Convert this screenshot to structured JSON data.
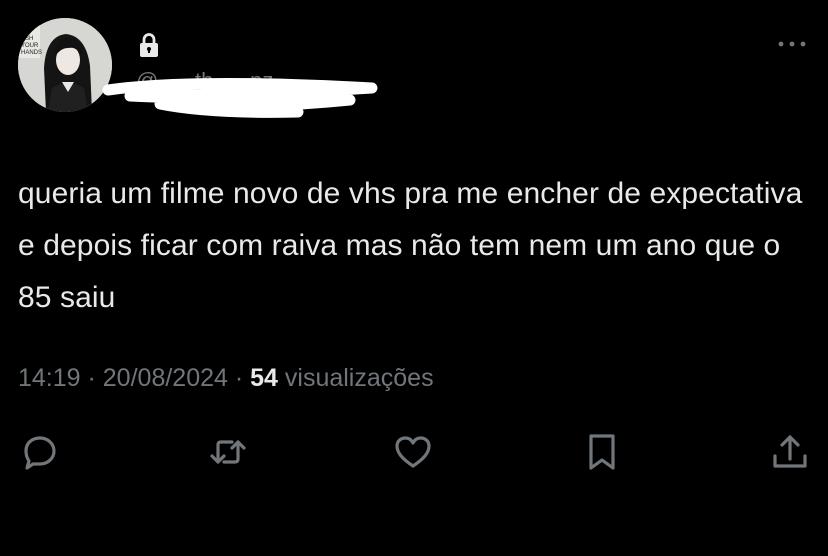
{
  "user": {
    "handle": "@___th___nz",
    "protected": true,
    "avatar_text": [
      "ASH",
      "YOUR",
      "HANDS"
    ]
  },
  "tweet": {
    "text": "queria um filme novo de vhs pra me encher de expectativa e depois ficar com raiva mas não tem nem um ano que o 85 saiu"
  },
  "meta": {
    "time": "14:19",
    "separator": " · ",
    "date": "20/08/2024",
    "views_count": "54",
    "views_label": " visualizações"
  },
  "icons": {
    "lock": "lock-icon",
    "more": "more-icon",
    "reply": "reply-icon",
    "retweet": "retweet-icon",
    "like": "like-icon",
    "bookmark": "bookmark-icon",
    "share": "share-icon"
  },
  "colors": {
    "background": "#000000",
    "text": "#e7e9ea",
    "muted": "#71767b"
  }
}
